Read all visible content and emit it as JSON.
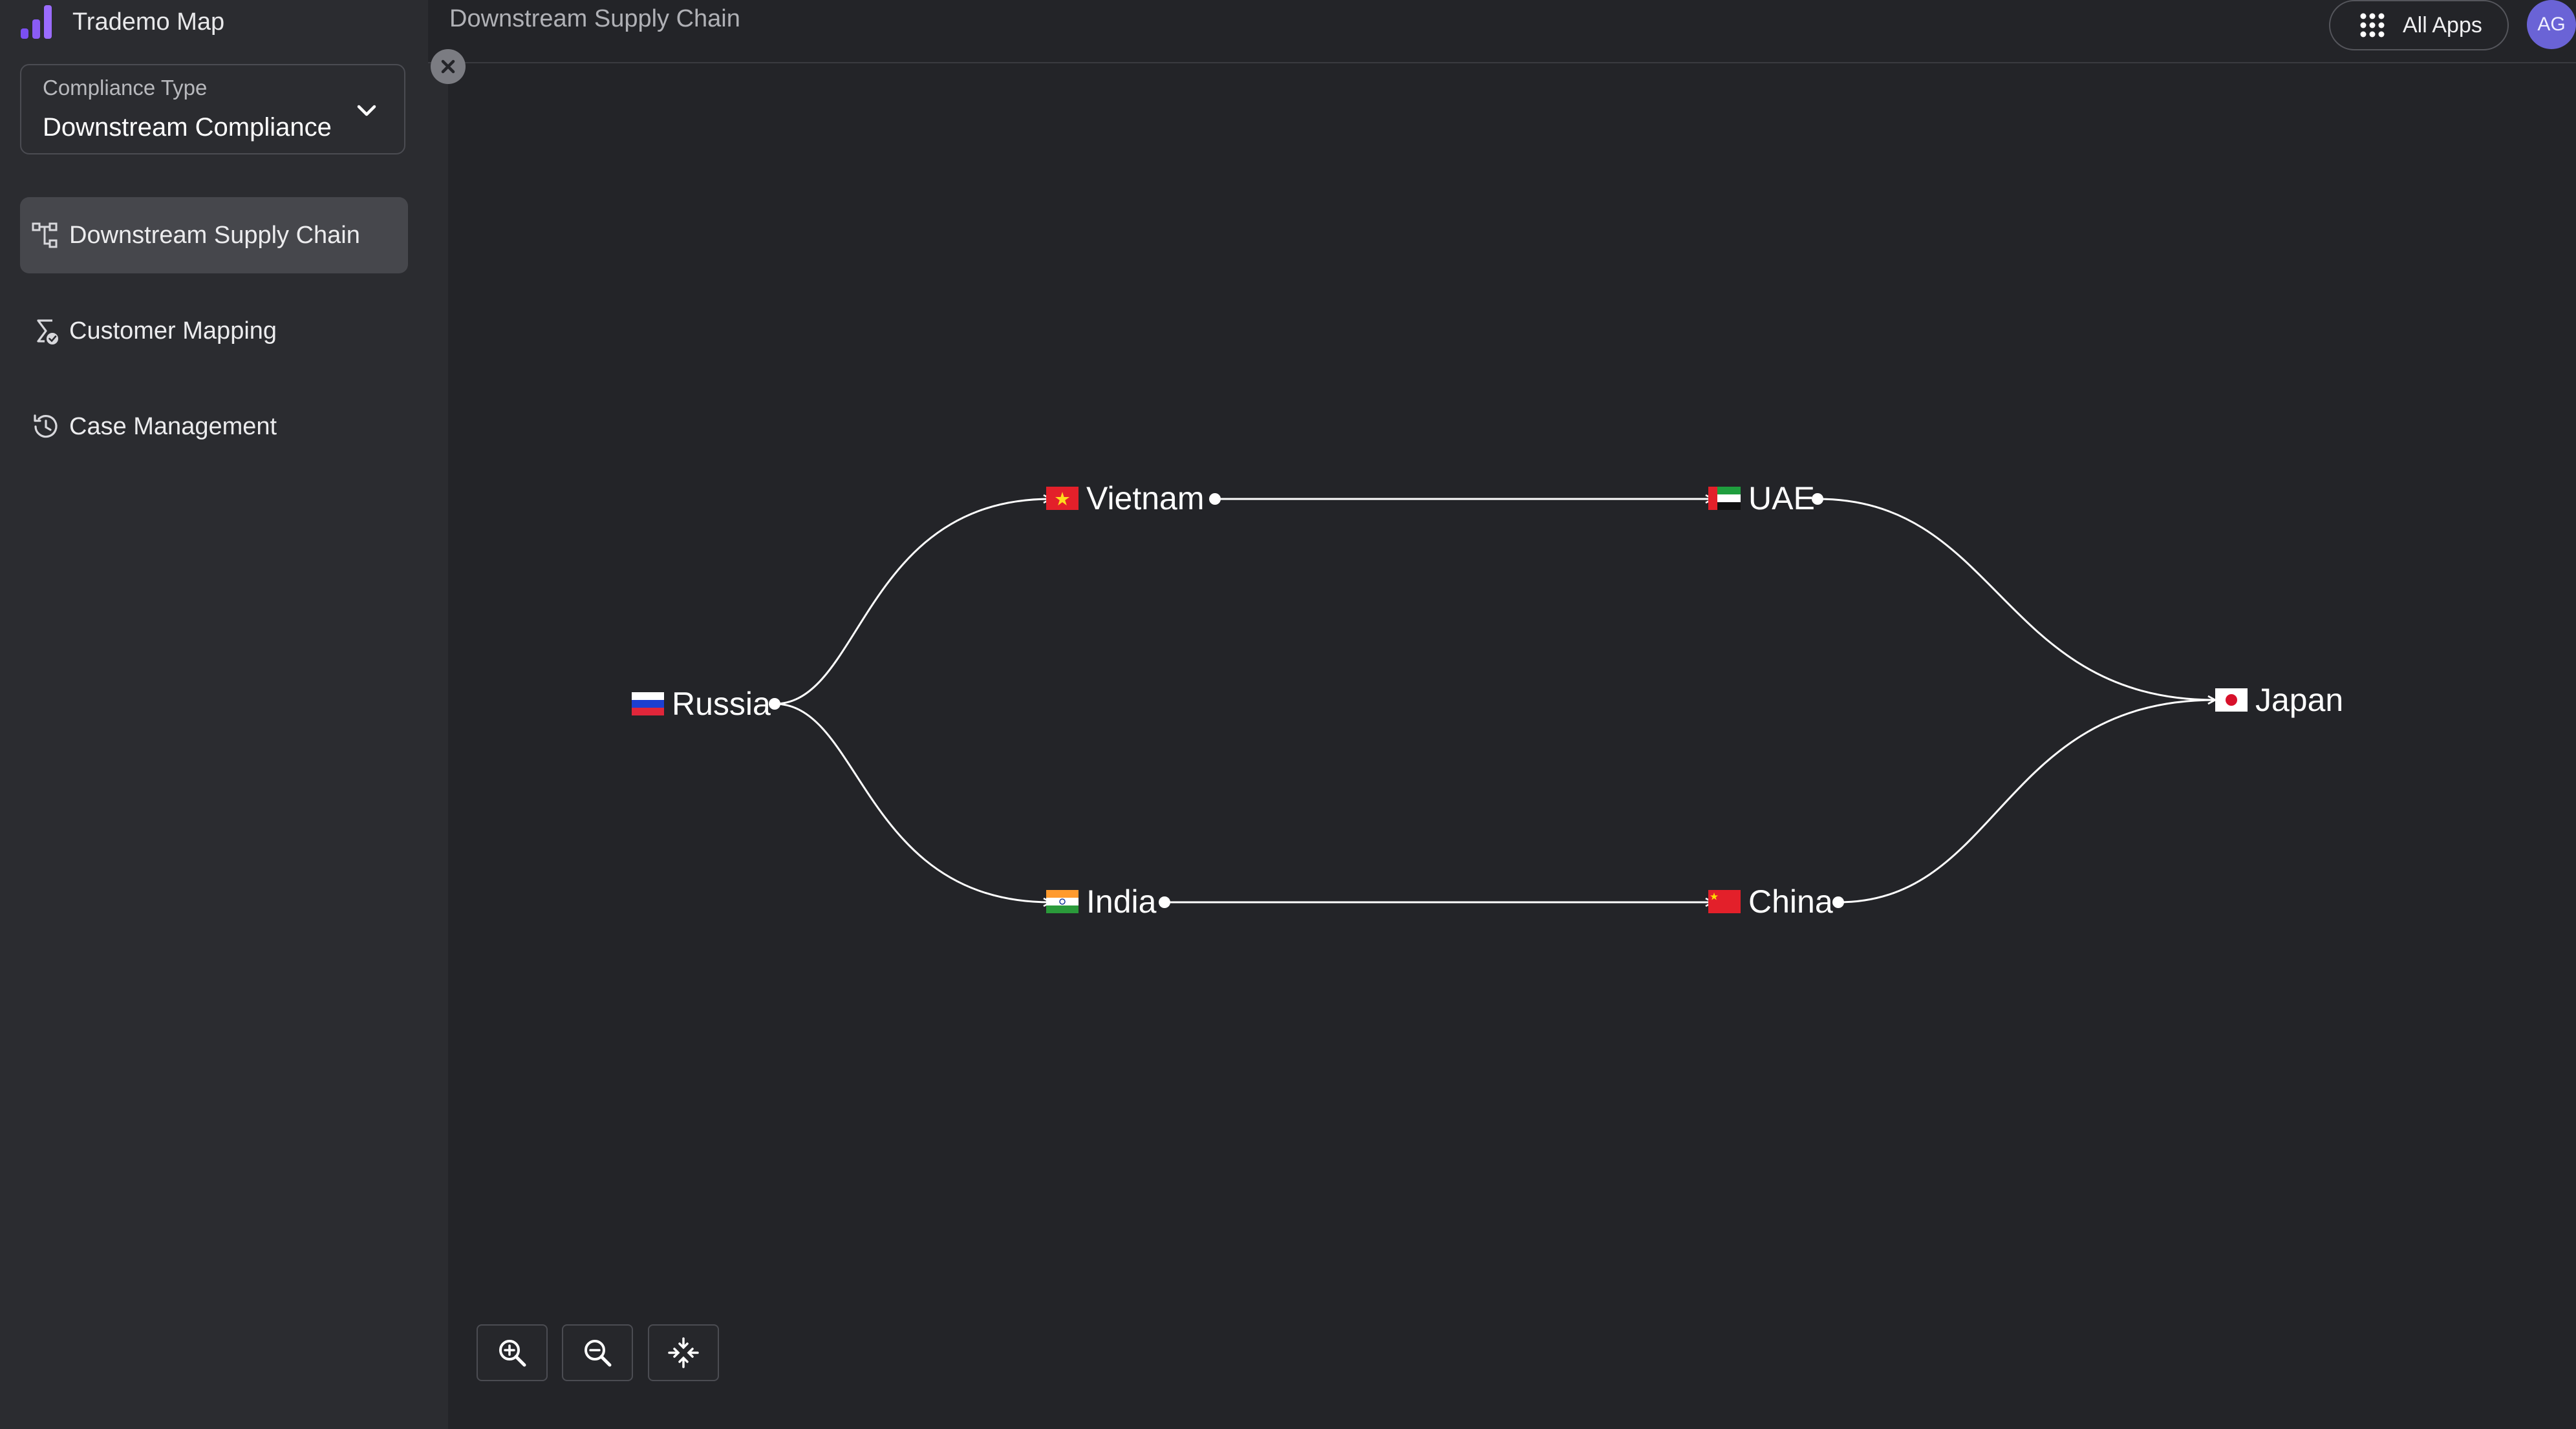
{
  "app": {
    "name": "Trademo Map"
  },
  "compliance": {
    "label": "Compliance Type",
    "value": "Downstream Compliance"
  },
  "nav": [
    {
      "label": "Downstream Supply Chain",
      "icon": "hierarchy-icon",
      "active": true
    },
    {
      "label": "Customer Mapping",
      "icon": "customer-mapping-icon",
      "active": false
    },
    {
      "label": "Case Management",
      "icon": "history-icon",
      "active": false
    }
  ],
  "header": {
    "title": "Downstream Supply Chain",
    "all_apps": "All Apps",
    "avatar": "AG"
  },
  "graph": {
    "nodes": [
      {
        "id": "russia",
        "label": "Russia",
        "flag": "flag-russia-icon"
      },
      {
        "id": "vietnam",
        "label": "Vietnam",
        "flag": "flag-vietnam-icon"
      },
      {
        "id": "india",
        "label": "India",
        "flag": "flag-india-icon"
      },
      {
        "id": "uae",
        "label": "UAE",
        "flag": "flag-uae-icon"
      },
      {
        "id": "china",
        "label": "China",
        "flag": "flag-china-icon"
      },
      {
        "id": "japan",
        "label": "Japan",
        "flag": "flag-japan-icon"
      }
    ],
    "edges": [
      {
        "from": "russia",
        "to": "vietnam"
      },
      {
        "from": "russia",
        "to": "india"
      },
      {
        "from": "vietnam",
        "to": "uae"
      },
      {
        "from": "india",
        "to": "china"
      },
      {
        "from": "uae",
        "to": "japan"
      },
      {
        "from": "china",
        "to": "japan"
      }
    ]
  },
  "controls": [
    "zoom-in-icon",
    "zoom-out-icon",
    "fit-view-icon"
  ],
  "colors": {
    "accent": "#7b4ff0",
    "avatar": "#6a63d6",
    "background": "#232428",
    "sidebar": "#2b2c30"
  }
}
